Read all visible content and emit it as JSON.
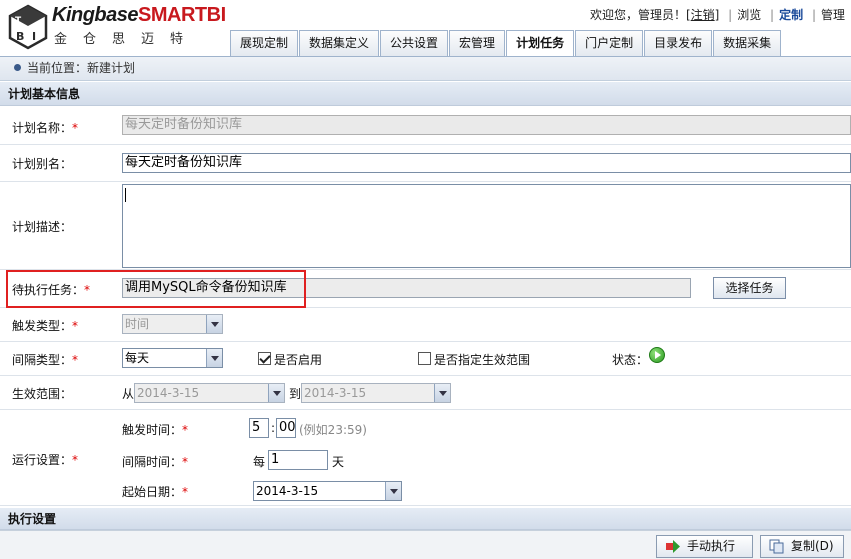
{
  "header": {
    "brand_main": "Kingbase",
    "brand_accent": "SMARTBI",
    "brand_cn": "金仓思迈特",
    "welcome": "欢迎您，管理员！[",
    "logout": "注销",
    "welcome_end": "]",
    "links": [
      "浏览",
      "定制",
      "管理"
    ],
    "active_link": "定制"
  },
  "tabs": [
    {
      "label": "展现定制",
      "active": false
    },
    {
      "label": "数据集定义",
      "active": false
    },
    {
      "label": "公共设置",
      "active": false
    },
    {
      "label": "宏管理",
      "active": false
    },
    {
      "label": "计划任务",
      "active": true
    },
    {
      "label": "门户定制",
      "active": false
    },
    {
      "label": "目录发布",
      "active": false
    },
    {
      "label": "数据采集",
      "active": false
    }
  ],
  "breadcrumb": "当前位置：新建计划",
  "sections": {
    "basic": "计划基本信息",
    "exec": "执行设置"
  },
  "form": {
    "name_label": "计划名称：",
    "name_value": "每天定时备份知识库",
    "alias_label": "计划别名：",
    "alias_value": "每天定时备份知识库",
    "desc_label": "计划描述：",
    "desc_value": "",
    "task_label": "待执行任务：",
    "task_value": "调用MySQL命令备份知识库",
    "choose_task": "选择任务",
    "trigger_label": "触发类型：",
    "trigger_value": "时间",
    "interval_label": "间隔类型：",
    "interval_value": "每天",
    "enabled_label": "是否启用",
    "enabled_checked": true,
    "range_check_label": "是否指定生效范围",
    "range_checked": false,
    "status_label": "状态：",
    "range_label": "生效范围：",
    "from_label": "从",
    "from_value": "2014-3-15",
    "to_label": "到",
    "to_value": "2014-3-15",
    "run_label": "运行设置：",
    "trigger_time_label": "触发时间：",
    "hour": "5",
    "time_sep": ":",
    "minute": "00",
    "time_hint": "(例如23:59)",
    "interval_time_label": "间隔时间：",
    "every": "每",
    "interval_num": "1",
    "day_unit": "天",
    "start_date_label": "起始日期：",
    "start_date": "2014-3-15",
    "required_mark": "*"
  },
  "toolbar": {
    "run_manual": "手动执行",
    "copy": "复制(D)"
  },
  "colors": {
    "accent_red": "#c8191e",
    "highlight": "#e02020",
    "tab_border": "#9fb3cc"
  }
}
